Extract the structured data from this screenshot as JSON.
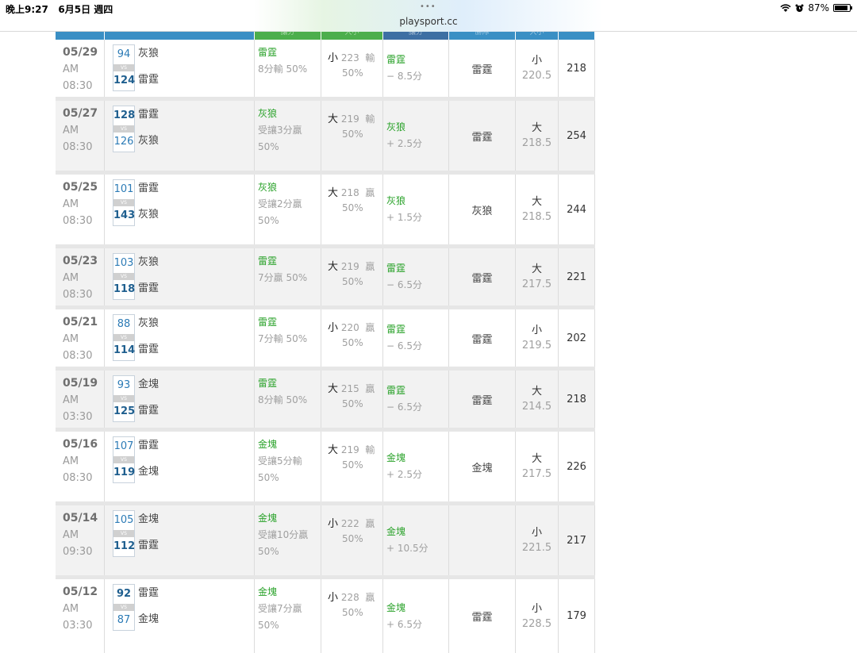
{
  "status_bar": {
    "time": "晚上9:27",
    "date": "6月5日 週四",
    "dots": "•••",
    "url": "playsport.cc",
    "battery": "87%",
    "battery_level": 0.87
  },
  "header": {
    "col_spread": "讓分",
    "col_ou": "大小",
    "col_pick": "讓分",
    "col_winner": "勝隊",
    "col_line": "大小"
  },
  "games": [
    {
      "md": "05/29",
      "ampm": "AM",
      "time": "08:30",
      "s1": "94",
      "t1": "灰狼",
      "s2": "124",
      "t2": "雷霆",
      "win": 2,
      "vs": "VS",
      "spread_team": "雷霆",
      "spread_l1": "8分輸 50%",
      "spread_l2": "",
      "ou_lead": "小",
      "ou_val": "223",
      "ou_res": "輸",
      "ou_pct": "50%",
      "pick_team": "雷霆",
      "pick_line": "− 8.5分",
      "winner": "雷霆",
      "line_dir": "小",
      "line_val": "220.5",
      "total": "218"
    },
    {
      "md": "05/27",
      "ampm": "AM",
      "time": "08:30",
      "s1": "128",
      "t1": "雷霆",
      "s2": "126",
      "t2": "灰狼",
      "win": 1,
      "vs": "VS",
      "spread_team": "灰狼",
      "spread_l1": "受讓3分贏",
      "spread_l2": "50%",
      "ou_lead": "大",
      "ou_val": "219",
      "ou_res": "輸",
      "ou_pct": "50%",
      "pick_team": "灰狼",
      "pick_line": "+ 2.5分",
      "winner": "雷霆",
      "line_dir": "大",
      "line_val": "218.5",
      "total": "254"
    },
    {
      "md": "05/25",
      "ampm": "AM",
      "time": "08:30",
      "s1": "101",
      "t1": "雷霆",
      "s2": "143",
      "t2": "灰狼",
      "win": 2,
      "vs": "VS",
      "spread_team": "灰狼",
      "spread_l1": "受讓2分贏",
      "spread_l2": "50%",
      "ou_lead": "大",
      "ou_val": "218",
      "ou_res": "贏",
      "ou_pct": "50%",
      "pick_team": "灰狼",
      "pick_line": "+ 1.5分",
      "winner": "灰狼",
      "line_dir": "大",
      "line_val": "218.5",
      "total": "244"
    },
    {
      "md": "05/23",
      "ampm": "AM",
      "time": "08:30",
      "s1": "103",
      "t1": "灰狼",
      "s2": "118",
      "t2": "雷霆",
      "win": 2,
      "vs": "VS",
      "spread_team": "雷霆",
      "spread_l1": "7分贏 50%",
      "spread_l2": "",
      "ou_lead": "大",
      "ou_val": "219",
      "ou_res": "贏",
      "ou_pct": "50%",
      "pick_team": "雷霆",
      "pick_line": "− 6.5分",
      "winner": "雷霆",
      "line_dir": "大",
      "line_val": "217.5",
      "total": "221"
    },
    {
      "md": "05/21",
      "ampm": "AM",
      "time": "08:30",
      "s1": "88",
      "t1": "灰狼",
      "s2": "114",
      "t2": "雷霆",
      "win": 2,
      "vs": "VS",
      "spread_team": "雷霆",
      "spread_l1": "7分輸 50%",
      "spread_l2": "",
      "ou_lead": "小",
      "ou_val": "220",
      "ou_res": "贏",
      "ou_pct": "50%",
      "pick_team": "雷霆",
      "pick_line": "− 6.5分",
      "winner": "雷霆",
      "line_dir": "小",
      "line_val": "219.5",
      "total": "202"
    },
    {
      "md": "05/19",
      "ampm": "AM",
      "time": "03:30",
      "s1": "93",
      "t1": "金塊",
      "s2": "125",
      "t2": "雷霆",
      "win": 2,
      "vs": "VS",
      "spread_team": "雷霆",
      "spread_l1": "8分輸 50%",
      "spread_l2": "",
      "ou_lead": "大",
      "ou_val": "215",
      "ou_res": "贏",
      "ou_pct": "50%",
      "pick_team": "雷霆",
      "pick_line": "− 6.5分",
      "winner": "雷霆",
      "line_dir": "大",
      "line_val": "214.5",
      "total": "218"
    },
    {
      "md": "05/16",
      "ampm": "AM",
      "time": "08:30",
      "s1": "107",
      "t1": "雷霆",
      "s2": "119",
      "t2": "金塊",
      "win": 2,
      "vs": "VS",
      "spread_team": "金塊",
      "spread_l1": "受讓5分輸",
      "spread_l2": "50%",
      "ou_lead": "大",
      "ou_val": "219",
      "ou_res": "輸",
      "ou_pct": "50%",
      "pick_team": "金塊",
      "pick_line": "+ 2.5分",
      "winner": "金塊",
      "line_dir": "大",
      "line_val": "217.5",
      "total": "226"
    },
    {
      "md": "05/14",
      "ampm": "AM",
      "time": "09:30",
      "s1": "105",
      "t1": "金塊",
      "s2": "112",
      "t2": "雷霆",
      "win": 2,
      "vs": "VS",
      "spread_team": "金塊",
      "spread_l1": "受讓10分贏",
      "spread_l2": "50%",
      "ou_lead": "小",
      "ou_val": "222",
      "ou_res": "贏",
      "ou_pct": "50%",
      "pick_team": "金塊",
      "pick_line": "+ 10.5分",
      "winner": "",
      "line_dir": "小",
      "line_val": "221.5",
      "total": "217"
    },
    {
      "md": "05/12",
      "ampm": "AM",
      "time": "03:30",
      "s1": "92",
      "t1": "雷霆",
      "s2": "87",
      "t2": "金塊",
      "win": 1,
      "vs": "VS",
      "spread_team": "金塊",
      "spread_l1": "受讓7分贏",
      "spread_l2": "50%",
      "ou_lead": "小",
      "ou_val": "228",
      "ou_res": "贏",
      "ou_pct": "50%",
      "pick_team": "金塊",
      "pick_line": "+ 6.5分",
      "winner": "雷霆",
      "line_dir": "小",
      "line_val": "228.5",
      "total": "179"
    }
  ],
  "colors": {
    "header_blue": "#3a8fc4",
    "header_green": "#4cae4c",
    "header_dark": "#3d6fa3",
    "team_green": "#2aa22a",
    "score_blue": "#2c7bb6"
  }
}
